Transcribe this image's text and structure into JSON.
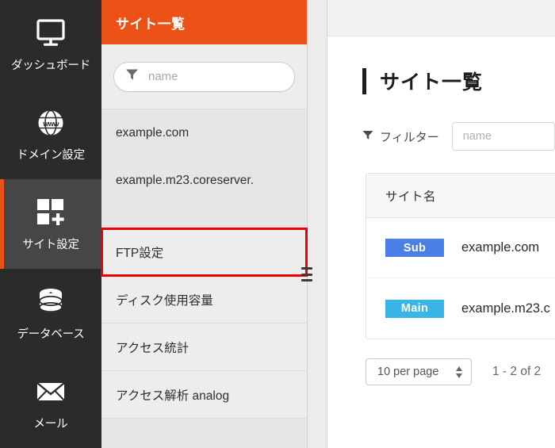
{
  "colors": {
    "brand_orange": "#ec5118",
    "rail_bg": "#2b2b2b",
    "rail_active_bg": "#464646",
    "highlight_red": "#ee0000",
    "badge_sub": "#4a7fe8",
    "badge_main": "#3ab5e8"
  },
  "nav_rail": {
    "items": [
      {
        "icon": "monitor-icon",
        "label": "ダッシュボード",
        "active": false
      },
      {
        "icon": "globe-www-icon",
        "label": "ドメイン設定",
        "active": false
      },
      {
        "icon": "site-settings-icon",
        "label": "サイト設定",
        "active": true
      },
      {
        "icon": "database-icon",
        "label": "データベース",
        "active": false
      },
      {
        "icon": "mail-icon",
        "label": "メール",
        "active": false
      }
    ]
  },
  "list_panel": {
    "header_title": "サイト一覧",
    "search": {
      "icon": "filter-funnel-icon",
      "placeholder": "name",
      "value": ""
    },
    "sites": [
      {
        "label": "example.com"
      },
      {
        "label": "example.m23.coreserver."
      }
    ],
    "menu": [
      {
        "label": "FTP設定",
        "highlighted": true
      },
      {
        "label": "ディスク使用容量",
        "highlighted": false
      },
      {
        "label": "アクセス統計",
        "highlighted": false
      },
      {
        "label": "アクセス解析 analog",
        "highlighted": false
      }
    ],
    "grip": "drag-handle-icon"
  },
  "main": {
    "page_title": "サイト一覧",
    "filter": {
      "icon": "filter-funnel-icon",
      "label": "フィルター",
      "placeholder": "name",
      "value": ""
    },
    "table": {
      "columns": [
        "サイト名"
      ],
      "rows": [
        {
          "badge": "Sub",
          "badge_color": "#4a7fe8",
          "name": "example.com"
        },
        {
          "badge": "Main",
          "badge_color": "#3ab5e8",
          "name": "example.m23.c"
        }
      ]
    },
    "pagination": {
      "per_page_label": "10 per page",
      "range_label": "1 - 2 of 2"
    }
  }
}
